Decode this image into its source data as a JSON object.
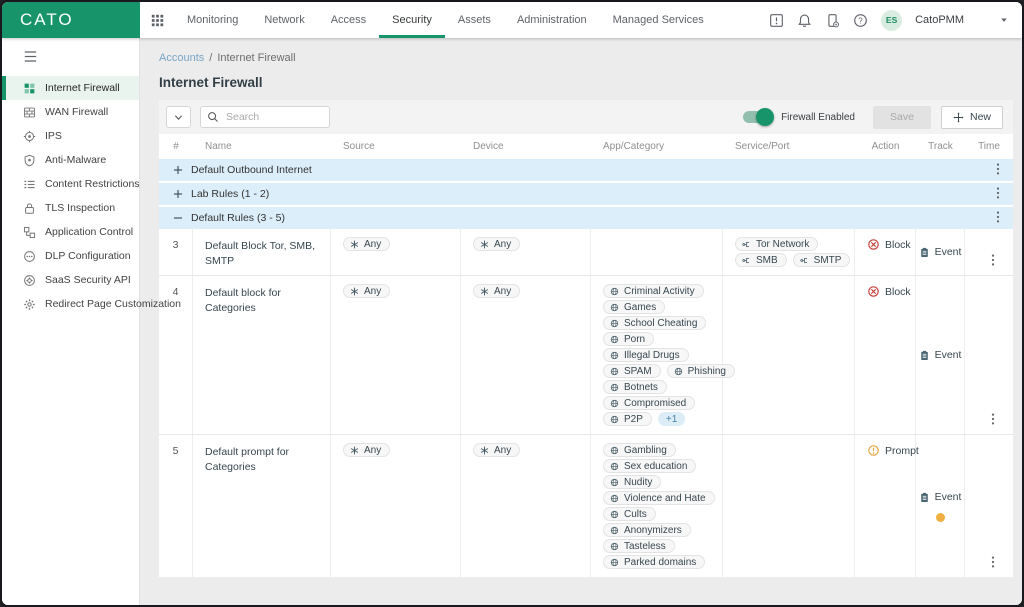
{
  "topbar": {
    "logo": "CATO",
    "nav": [
      {
        "label": "Monitoring",
        "active": false
      },
      {
        "label": "Network",
        "active": false
      },
      {
        "label": "Access",
        "active": false
      },
      {
        "label": "Security",
        "active": true
      },
      {
        "label": "Assets",
        "active": false
      },
      {
        "label": "Administration",
        "active": false
      },
      {
        "label": "Managed Services",
        "active": false
      }
    ],
    "icons": [
      "announcement",
      "notifications",
      "device-status",
      "help"
    ],
    "avatar_initials": "ES",
    "account_name": "CatoPMM"
  },
  "sidebar": {
    "items": [
      {
        "label": "Internet Firewall",
        "icon": "internet-firewall",
        "active": true
      },
      {
        "label": "WAN Firewall",
        "icon": "wan-firewall",
        "active": false
      },
      {
        "label": "IPS",
        "icon": "ips",
        "active": false
      },
      {
        "label": "Anti-Malware",
        "icon": "anti-malware",
        "active": false
      },
      {
        "label": "Content Restrictions",
        "icon": "content-restrictions",
        "active": false
      },
      {
        "label": "TLS Inspection",
        "icon": "tls-inspection",
        "active": false
      },
      {
        "label": "Application Control",
        "icon": "application-control",
        "active": false
      },
      {
        "label": "DLP Configuration",
        "icon": "dlp-configuration",
        "active": false
      },
      {
        "label": "SaaS Security API",
        "icon": "saas-security-api",
        "active": false
      },
      {
        "label": "Redirect Page Customization",
        "icon": "redirect-page-customization",
        "active": false
      }
    ]
  },
  "breadcrumb": {
    "parent": "Accounts",
    "separator": "/",
    "current": "Internet Firewall"
  },
  "page_title": "Internet Firewall",
  "toolbar": {
    "search_placeholder": "Search",
    "firewall_toggle": {
      "label": "Firewall Enabled",
      "enabled": true
    },
    "save_label": "Save",
    "new_label": "New"
  },
  "table": {
    "columns": [
      "#",
      "Name",
      "Source",
      "Device",
      "App/Category",
      "Service/Port",
      "Action",
      "Track",
      "Time"
    ],
    "groups": [
      {
        "label": "Default Outbound Internet",
        "expanded": false,
        "rules": []
      },
      {
        "label": "Lab Rules (1 - 2)",
        "expanded": false,
        "rules": []
      },
      {
        "label": "Default Rules (3 - 5)",
        "expanded": true,
        "rules": [
          {
            "num": "3",
            "name": "Default Block Tor, SMB, SMTP",
            "source": "Any",
            "device": "Any",
            "app_category_rows": [],
            "service_port_rows": [
              [
                "Tor Network"
              ],
              [
                "SMB",
                "SMTP"
              ]
            ],
            "action": {
              "label": "Block",
              "type": "block"
            },
            "track": {
              "label": "Event",
              "dot": false
            }
          },
          {
            "num": "4",
            "name": "Default block for Categories",
            "source": "Any",
            "device": "Any",
            "app_category_rows": [
              [
                "Criminal Activity"
              ],
              [
                "Games"
              ],
              [
                "School Cheating"
              ],
              [
                "Porn"
              ],
              [
                "Illegal Drugs"
              ],
              [
                "SPAM",
                "Phishing"
              ],
              [
                "Botnets"
              ],
              [
                "Compromised"
              ],
              [
                "P2P",
                {
                  "label": "+1",
                  "type": "more"
                }
              ]
            ],
            "service_port_rows": [],
            "action": {
              "label": "Block",
              "type": "block"
            },
            "track": {
              "label": "Event",
              "dot": false
            }
          },
          {
            "num": "5",
            "name": "Default prompt for Categories",
            "source": "Any",
            "device": "Any",
            "app_category_rows": [
              [
                "Gambling"
              ],
              [
                "Sex education"
              ],
              [
                "Nudity"
              ],
              [
                "Violence and Hate"
              ],
              [
                "Cults"
              ],
              [
                "Anonymizers"
              ],
              [
                "Tasteless"
              ],
              [
                "Parked domains"
              ]
            ],
            "service_port_rows": [],
            "action": {
              "label": "Prompt",
              "type": "prompt"
            },
            "track": {
              "label": "Event",
              "dot": true
            }
          }
        ]
      }
    ]
  },
  "colors": {
    "brand_green": "#17946a",
    "group_row_blue": "#dceef9",
    "block_red": "#c43a31",
    "prompt_amber": "#e8a33d",
    "track_dot_orange": "#efb041",
    "event_slate": "#4a6572"
  }
}
